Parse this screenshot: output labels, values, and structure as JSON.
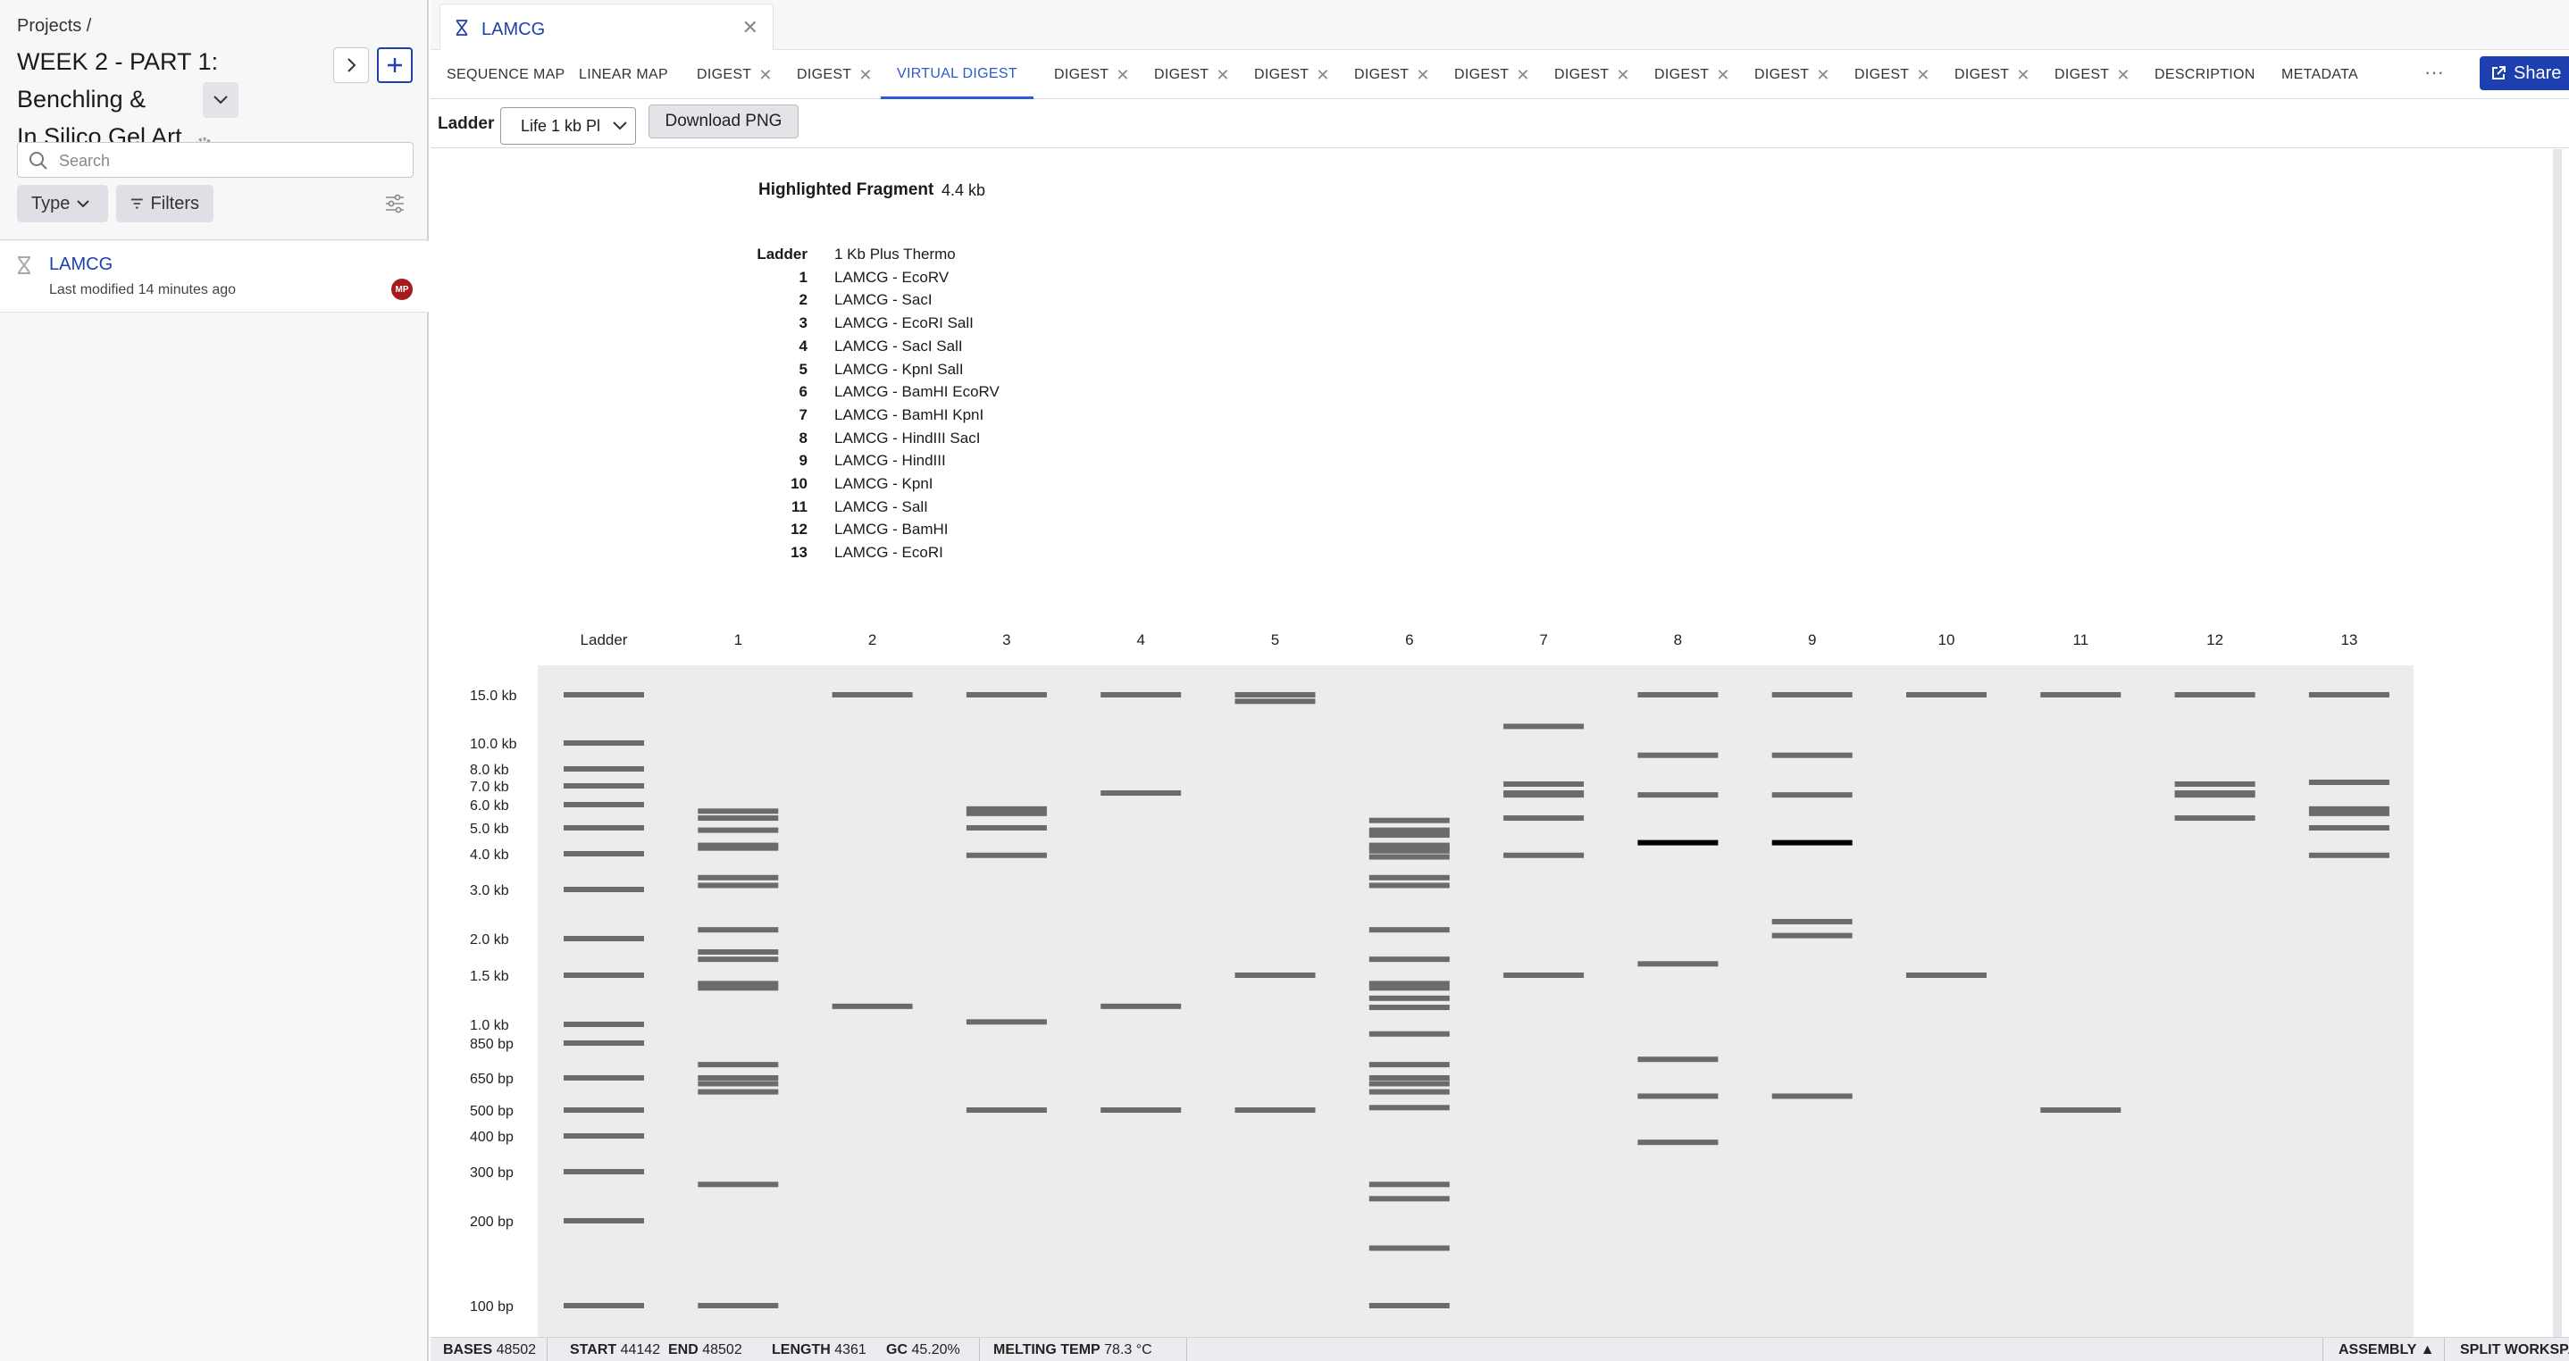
{
  "sidebar": {
    "breadcrumb": "Projects /",
    "title_line1": "WEEK 2 - PART 1: Benchling &",
    "title_line2": "In Silico Gel Art",
    "search_placeholder": "Search",
    "type_filter": "Type",
    "filters_button": "Filters",
    "items": [
      {
        "name": "LAMCG",
        "modified": "Last modified 14 minutes ago",
        "avatar": "MP"
      }
    ]
  },
  "document_tab": {
    "label": "LAMCG"
  },
  "view_tabs": [
    {
      "label": "SEQUENCE MAP",
      "closable": false
    },
    {
      "label": "LINEAR MAP",
      "closable": false
    },
    {
      "label": "DIGEST",
      "closable": true
    },
    {
      "label": "DIGEST",
      "closable": true
    },
    {
      "label": "VIRTUAL DIGEST",
      "closable": false,
      "active": true
    },
    {
      "label": "DIGEST",
      "closable": true
    },
    {
      "label": "DIGEST",
      "closable": true
    },
    {
      "label": "DIGEST",
      "closable": true
    },
    {
      "label": "DIGEST",
      "closable": true
    },
    {
      "label": "DIGEST",
      "closable": true
    },
    {
      "label": "DIGEST",
      "closable": true
    },
    {
      "label": "DIGEST",
      "closable": true
    },
    {
      "label": "DIGEST",
      "closable": true
    },
    {
      "label": "DIGEST",
      "closable": true
    },
    {
      "label": "DIGEST",
      "closable": true
    },
    {
      "label": "DIGEST",
      "closable": true
    },
    {
      "label": "DESCRIPTION",
      "closable": false
    },
    {
      "label": "METADATA",
      "closable": false
    }
  ],
  "share_button": "Share",
  "toolbar": {
    "ladder_label": "Ladder",
    "ladder_selected": "Life 1 kb Pl",
    "download_button": "Download PNG"
  },
  "highlighted": {
    "label": "Highlighted Fragment",
    "value": "4.4 kb"
  },
  "legend": {
    "header_label": "Ladder",
    "header_value": "1 Kb Plus Thermo",
    "lanes": [
      {
        "num": "1",
        "name": "LAMCG - EcoRV"
      },
      {
        "num": "2",
        "name": "LAMCG - SacI"
      },
      {
        "num": "3",
        "name": "LAMCG - EcoRI SalI"
      },
      {
        "num": "4",
        "name": "LAMCG - SacI SalI"
      },
      {
        "num": "5",
        "name": "LAMCG - KpnI SalI"
      },
      {
        "num": "6",
        "name": "LAMCG - BamHI EcoRV"
      },
      {
        "num": "7",
        "name": "LAMCG - BamHI KpnI"
      },
      {
        "num": "8",
        "name": "LAMCG - HindIII SacI"
      },
      {
        "num": "9",
        "name": "LAMCG - HindIII"
      },
      {
        "num": "10",
        "name": "LAMCG - KpnI"
      },
      {
        "num": "11",
        "name": "LAMCG - SalI"
      },
      {
        "num": "12",
        "name": "LAMCG - BamHI"
      },
      {
        "num": "13",
        "name": "LAMCG - EcoRI"
      }
    ]
  },
  "gel": {
    "lane_labels": [
      "Ladder",
      "1",
      "2",
      "3",
      "4",
      "5",
      "6",
      "7",
      "8",
      "9",
      "10",
      "11",
      "12",
      "13"
    ],
    "size_labels": [
      "15.0 kb",
      "10.0 kb",
      "8.0 kb",
      "7.0 kb",
      "6.0 kb",
      "5.0 kb",
      "4.0 kb",
      "3.0 kb",
      "2.0 kb",
      "1.5 kb",
      "1.0 kb",
      "850 bp",
      "650 bp",
      "500 bp",
      "400 bp",
      "300 bp",
      "200 bp",
      "100 bp"
    ],
    "ladder_bp": [
      15000,
      10000,
      8000,
      7000,
      6000,
      5000,
      4000,
      3000,
      2000,
      1500,
      1000,
      850,
      650,
      500,
      400,
      300,
      200,
      100
    ],
    "highlighted_bp": 4400,
    "lanes_bp": [
      [
        5700,
        5400,
        4900,
        4300,
        4200,
        3300,
        3100,
        2150,
        1800,
        1700,
        1400,
        1350,
        720,
        650,
        620,
        580,
        270,
        100
      ],
      [
        15000,
        1160
      ],
      [
        15000,
        5800,
        5600,
        5000,
        3950,
        1020,
        500
      ],
      [
        15000,
        6600,
        1160,
        500
      ],
      [
        15000,
        14200,
        1500,
        500
      ],
      [
        5300,
        4900,
        4700,
        4300,
        4200,
        4100,
        3900,
        3300,
        3100,
        2150,
        1700,
        1400,
        1350,
        1240,
        1150,
        920,
        720,
        650,
        620,
        580,
        510,
        270,
        240,
        160,
        100
      ],
      [
        11500,
        7100,
        6600,
        6500,
        5400,
        3950,
        1500
      ],
      [
        15000,
        9000,
        6500,
        4400,
        1640,
        750,
        560,
        380
      ],
      [
        15000,
        9000,
        6500,
        4400,
        2300,
        2050,
        560
      ],
      [
        15000,
        1500
      ],
      [
        15000,
        500
      ],
      [
        15000,
        7100,
        6600,
        6500,
        5400
      ],
      [
        15000,
        7200,
        5800,
        5600,
        5000,
        3950
      ]
    ]
  },
  "status": {
    "bases_label": "BASES",
    "bases": "48502",
    "start_label": "START",
    "start": "44142",
    "end_label": "END",
    "end": "48502",
    "length_label": "LENGTH",
    "length": "4361",
    "gc_label": "GC",
    "gc": "45.20%",
    "melt_label": "MELTING TEMP",
    "melt": "78.3 °C",
    "assembly": "ASSEMBLY ▲",
    "split": "SPLIT WORKSPA"
  }
}
